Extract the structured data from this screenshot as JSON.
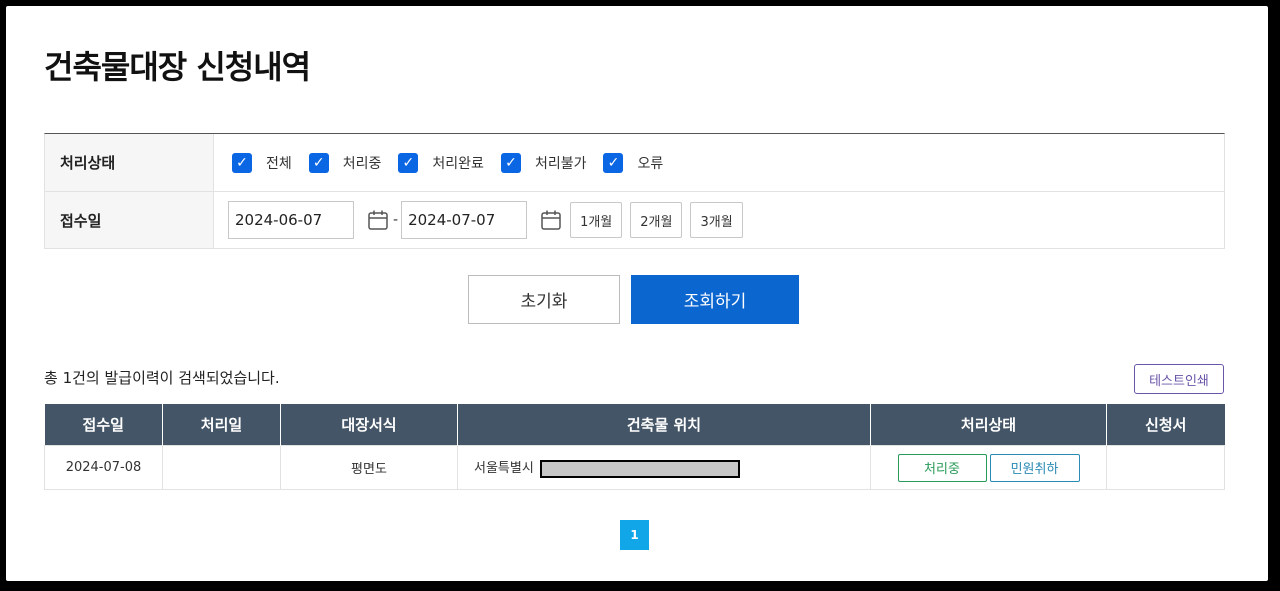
{
  "page": {
    "title": "건축물대장 신청내역"
  },
  "filter": {
    "status_label": "처리상태",
    "status_options": [
      {
        "label": "전체",
        "checked": true
      },
      {
        "label": "처리중",
        "checked": true
      },
      {
        "label": "처리완료",
        "checked": true
      },
      {
        "label": "처리불가",
        "checked": true
      },
      {
        "label": "오류",
        "checked": true
      }
    ],
    "date_label": "접수일",
    "date_from": "2024-06-07",
    "date_separator": "-",
    "date_to": "2024-07-07",
    "period_buttons": [
      "1개월",
      "2개월",
      "3개월"
    ]
  },
  "actions": {
    "reset": "초기화",
    "search": "조회하기"
  },
  "results": {
    "summary": "총 1건의 발급이력이 검색되었습니다.",
    "test_print": "테스트인쇄",
    "columns": [
      "접수일",
      "처리일",
      "대장서식",
      "건축물 위치",
      "처리상태",
      "신청서"
    ],
    "rows": [
      {
        "received": "2024-07-08",
        "processed": "",
        "form": "평면도",
        "location": "서울특별시",
        "status": "처리중",
        "cancel": "민원취하",
        "application": ""
      }
    ]
  },
  "pagination": {
    "current": "1"
  },
  "colors": {
    "primary": "#0b66d0",
    "header": "#435566",
    "checkbox": "#0b66e4",
    "pager": "#11a6e8"
  }
}
